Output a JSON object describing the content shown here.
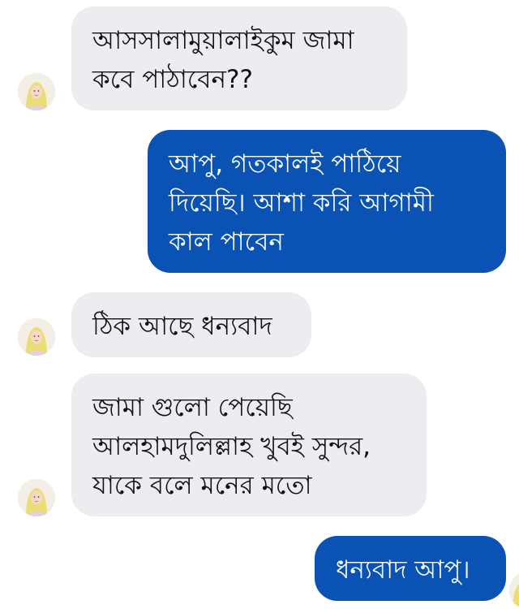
{
  "conversation": {
    "messages": [
      {
        "direction": "incoming",
        "text": "আসসালামুয়ালাইকুম জামা\nকবে  পাঠাবেন??"
      },
      {
        "direction": "outgoing",
        "text": "আপু, গতকালই পাঠিয়ে\nদিয়েছি। আশা করি আগামী\nকাল পাবেন"
      },
      {
        "direction": "incoming",
        "text": "ঠিক আছে ধন্যবাদ"
      },
      {
        "direction": "incoming",
        "text": "জামা গুলো পেয়েছি\nআলহামদুলিল্লাহ খুবই সুন্দর,\nযাকে বলে মনের মতো"
      },
      {
        "direction": "outgoing",
        "text": "ধন্যবাদ আপু।"
      }
    ]
  },
  "colors": {
    "incoming_bubble": "#ecedf0",
    "outgoing_bubble": "#0a53b5",
    "incoming_text": "#111111",
    "outgoing_text": "#ffffff"
  },
  "icons": {
    "contact_avatar": "avatar-icon"
  }
}
